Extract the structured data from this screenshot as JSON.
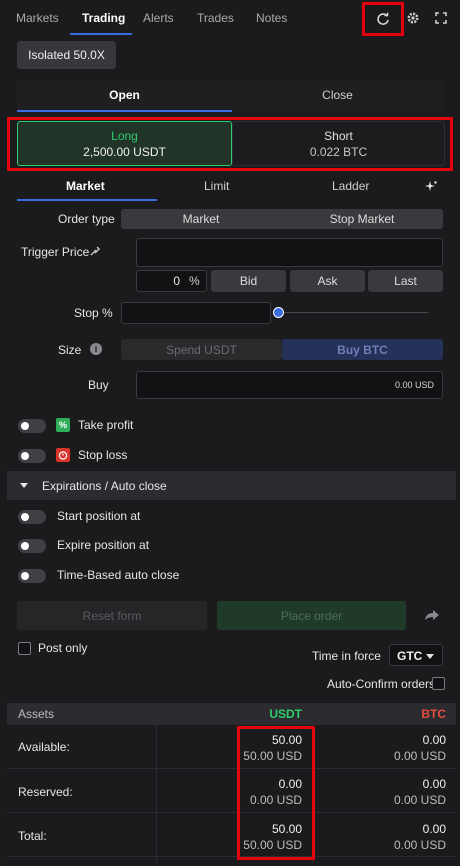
{
  "tabs": [
    {
      "label": "Markets"
    },
    {
      "label": "Trading"
    },
    {
      "label": "Alerts"
    },
    {
      "label": "Trades"
    },
    {
      "label": "Notes"
    }
  ],
  "icons": {
    "refresh": "refresh-icon",
    "settings": "gear-icon",
    "expand": "expand-icon"
  },
  "margin": {
    "label": "Isolated 50.0X"
  },
  "mode_tabs": [
    {
      "label": "Open"
    },
    {
      "label": "Close"
    }
  ],
  "side": {
    "long": {
      "label": "Long",
      "value": "2,500.00 USDT"
    },
    "short": {
      "label": "Short",
      "value": "0.022 BTC"
    }
  },
  "order_tabs": [
    {
      "label": "Market"
    },
    {
      "label": "Limit"
    },
    {
      "label": "Ladder"
    }
  ],
  "form": {
    "order_type_label": "Order type",
    "order_types": [
      "Market",
      "Stop Market"
    ],
    "trigger_price_label": "Trigger Price",
    "trigger_price_value": "",
    "pct_value": "0",
    "pct_unit": "%",
    "price_buttons": [
      "Bid",
      "Ask",
      "Last"
    ],
    "stop_label": "Stop %",
    "stop_value": "",
    "size_label": "Size",
    "size_options": [
      "Spend USDT",
      "Buy BTC"
    ],
    "buy_label": "Buy",
    "buy_value": "0.00 USD"
  },
  "toggles": {
    "take_profit": "Take profit",
    "stop_loss": "Stop loss",
    "expirations": "Expirations / Auto close",
    "start_position": "Start position at",
    "expire_position": "Expire position at",
    "time_based": "Time-Based auto close"
  },
  "actions": {
    "reset": "Reset form",
    "place": "Place order",
    "post_only": "Post only",
    "tif_label": "Time in force",
    "tif_value": "GTC",
    "auto_confirm": "Auto-Confirm orders"
  },
  "assets": {
    "header": "Assets",
    "col_usdt": "USDT",
    "col_btc": "BTC",
    "rows": [
      {
        "label": "Available:",
        "usdt": "50.00",
        "usdt_sub": "50.00 USD",
        "btc": "0.00",
        "btc_sub": "0.00 USD"
      },
      {
        "label": "Reserved:",
        "usdt": "0.00",
        "usdt_sub": "0.00 USD",
        "btc": "0.00",
        "btc_sub": "0.00 USD"
      },
      {
        "label": "Total:",
        "usdt": "50.00",
        "usdt_sub": "50.00 USD",
        "btc": "0.00",
        "btc_sub": "0.00 USD"
      }
    ]
  },
  "colors": {
    "accent": "#3b6de0",
    "long": "#2ecc71",
    "short": "#e74c3c"
  }
}
